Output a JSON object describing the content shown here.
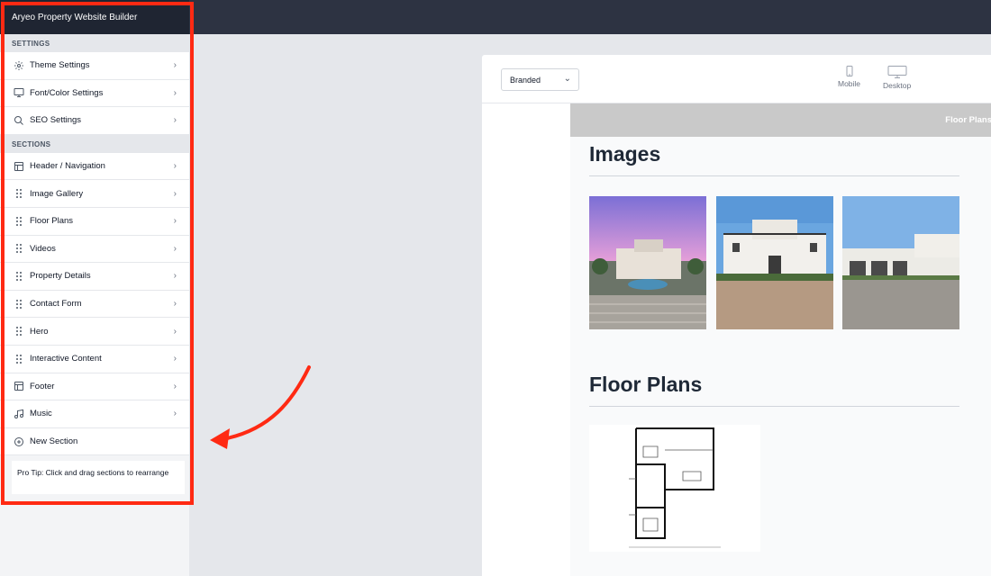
{
  "app": {
    "title": "Aryeo Property Website Builder"
  },
  "sidebar": {
    "settings_heading": "SETTINGS",
    "settings_items": [
      {
        "label": "Theme Settings",
        "icon": "gear-icon"
      },
      {
        "label": "Font/Color Settings",
        "icon": "monitor-icon"
      },
      {
        "label": "SEO Settings",
        "icon": "search-icon"
      }
    ],
    "sections_heading": "SECTIONS",
    "section_items": [
      {
        "label": "Header / Navigation",
        "icon": "layout-icon"
      },
      {
        "label": "Image Gallery",
        "icon": "drag-handle-icon"
      },
      {
        "label": "Floor Plans",
        "icon": "drag-handle-icon"
      },
      {
        "label": "Videos",
        "icon": "drag-handle-icon"
      },
      {
        "label": "Property Details",
        "icon": "drag-handle-icon"
      },
      {
        "label": "Contact Form",
        "icon": "drag-handle-icon"
      },
      {
        "label": "Hero",
        "icon": "drag-handle-icon"
      },
      {
        "label": "Interactive Content",
        "icon": "drag-handle-icon"
      },
      {
        "label": "Footer",
        "icon": "layout-icon"
      },
      {
        "label": "Music",
        "icon": "music-note-icon"
      }
    ],
    "new_section_label": "New Section",
    "pro_tip": "Pro Tip: Click and drag sections to rearrange"
  },
  "preview": {
    "theme_select": {
      "value": "Branded"
    },
    "devices": [
      {
        "label": "Mobile",
        "icon": "phone-icon"
      },
      {
        "label": "Desktop",
        "icon": "desktop-icon"
      }
    ],
    "nav_link": "Floor Plans",
    "images_heading": "Images",
    "floor_plans_heading": "Floor Plans"
  },
  "colors": {
    "highlight": "#ff2a13",
    "topbar": "#2d3342",
    "sidebar_title_bg": "#1f2532"
  }
}
